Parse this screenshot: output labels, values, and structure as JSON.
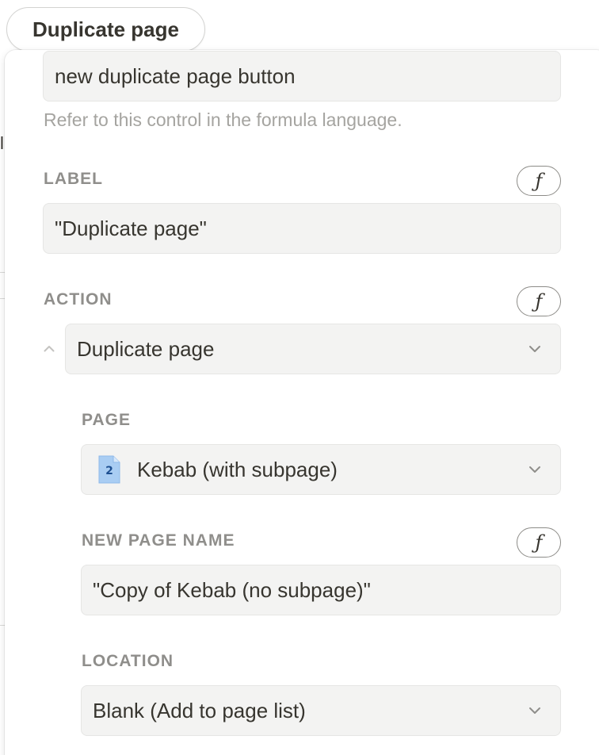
{
  "header": {
    "button_label": "Duplicate page"
  },
  "name_field": {
    "value": "new duplicate page button",
    "help": "Refer to this control in the formula language."
  },
  "label_section": {
    "title": "LABEL",
    "value": "\"Duplicate page\"",
    "formula_icon": "function-icon"
  },
  "action_section": {
    "title": "ACTION",
    "selected": "Duplicate page",
    "formula_icon": "function-icon",
    "page": {
      "title": "PAGE",
      "selected": "Kebab (with subpage)",
      "page_icon_number": "2"
    },
    "new_page_name": {
      "title": "NEW PAGE NAME",
      "value": "\"Copy of Kebab (no subpage)\""
    },
    "location": {
      "title": "LOCATION",
      "selected": "Blank (Add to page list)"
    }
  },
  "icons": {
    "fx": "ƒ",
    "chevron": "chevron-down-icon",
    "caret": "chevron-up-icon",
    "page": "page-icon"
  },
  "colors": {
    "field_bg": "#f3f3f2",
    "label_gray": "#8f8e8b",
    "help_gray": "#a5a4a0",
    "page_icon_blue": "#a9cdf3"
  }
}
